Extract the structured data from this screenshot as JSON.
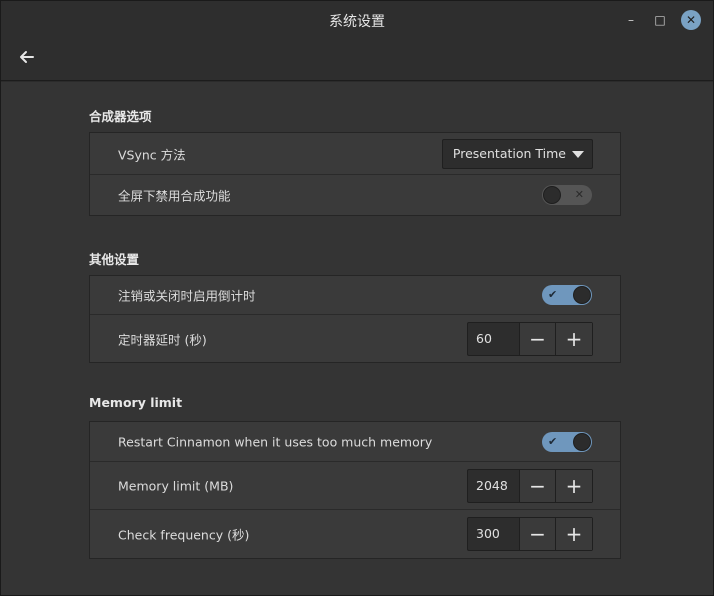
{
  "window": {
    "title": "系统设置"
  },
  "titlebar": {
    "minimize_glyph": "–",
    "maximize_glyph": "□",
    "close_glyph": "✕"
  },
  "sections": [
    {
      "title": "合成器选项",
      "rows": [
        {
          "label": "VSync 方法",
          "control": "dropdown",
          "value": "Presentation Time"
        },
        {
          "label": "全屏下禁用合成功能",
          "control": "switch",
          "checked": false
        }
      ]
    },
    {
      "title": "其他设置",
      "rows": [
        {
          "label": "注销或关闭时启用倒计时",
          "control": "switch",
          "checked": true
        },
        {
          "label": "定时器延时 (秒)",
          "control": "spin",
          "value": "60"
        }
      ]
    },
    {
      "title": "Memory limit",
      "rows": [
        {
          "label": "Restart Cinnamon when it uses too much memory",
          "control": "switch",
          "checked": true
        },
        {
          "label": "Memory limit (MB)",
          "control": "spin",
          "value": "2048"
        },
        {
          "label": "Check frequency (秒)",
          "control": "spin",
          "value": "300"
        }
      ]
    }
  ],
  "glyphs": {
    "check": "✔",
    "cross": "✕",
    "minus": "−",
    "plus": "+"
  },
  "colors": {
    "accent": "#6f97bd",
    "close_button": "#7aa2c4",
    "background": "#343434",
    "panel": "#3a3a3a"
  }
}
